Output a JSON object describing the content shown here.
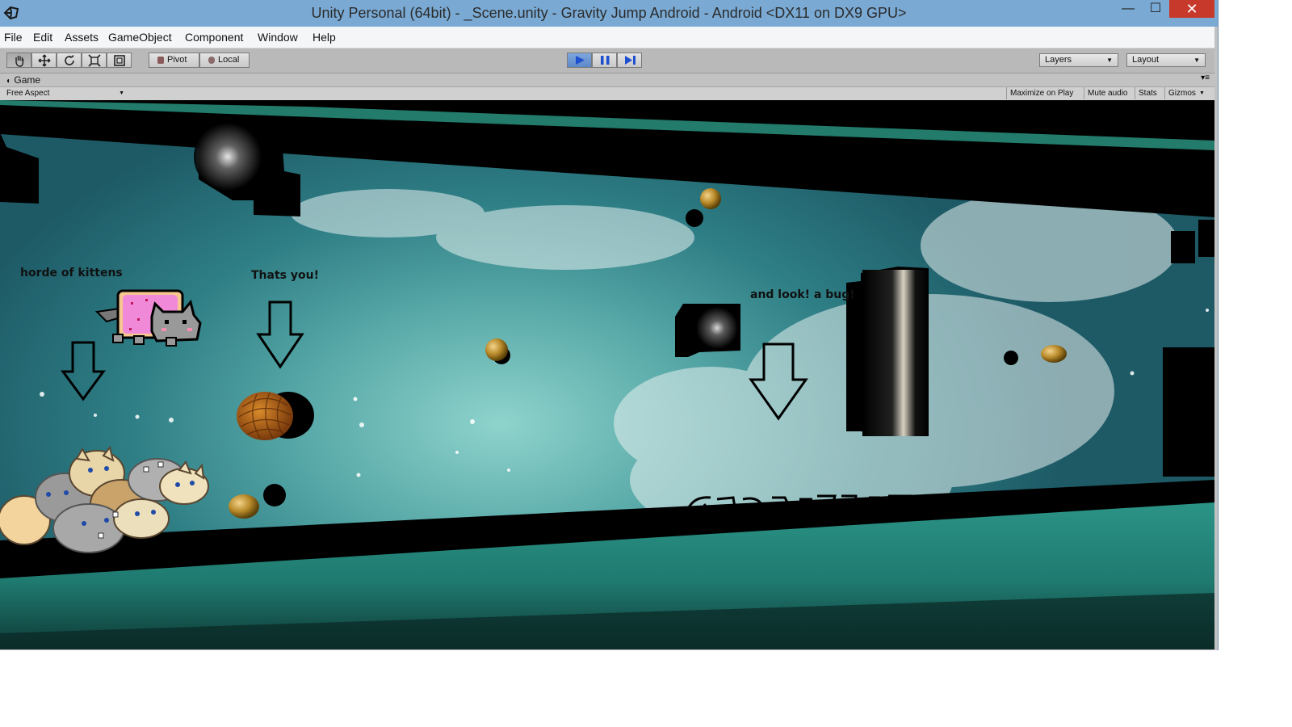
{
  "window": {
    "title": "Unity Personal (64bit) - _Scene.unity - Gravity Jump Android - Android <DX11 on DX9 GPU>",
    "controls": {
      "minimize": "—",
      "maximize": "☐",
      "close": "✕"
    },
    "colors": {
      "titlebar": "#7aaad4",
      "close": "#c7392b"
    }
  },
  "menu": [
    "File",
    "Edit",
    "Assets",
    "GameObject",
    "Component",
    "Window",
    "Help"
  ],
  "toolbar": {
    "tools": [
      "hand-icon",
      "move-icon",
      "rotate-icon",
      "scale-icon",
      "rect-icon"
    ],
    "pivot_label": "Pivot",
    "local_label": "Local",
    "playback": {
      "play_active": true,
      "accent": "#5e88c8"
    },
    "layers_label": "Layers",
    "layout_label": "Layout"
  },
  "game_panel": {
    "tab_label": "Game",
    "aspect": "Free Aspect",
    "buttons": [
      "Maximize on Play",
      "Mute audio",
      "Stats",
      "Gizmos"
    ]
  },
  "game_view": {
    "annotations": {
      "kittens": "horde of kittens",
      "player": "Thats you!",
      "bug": "and look! a bug!"
    }
  }
}
